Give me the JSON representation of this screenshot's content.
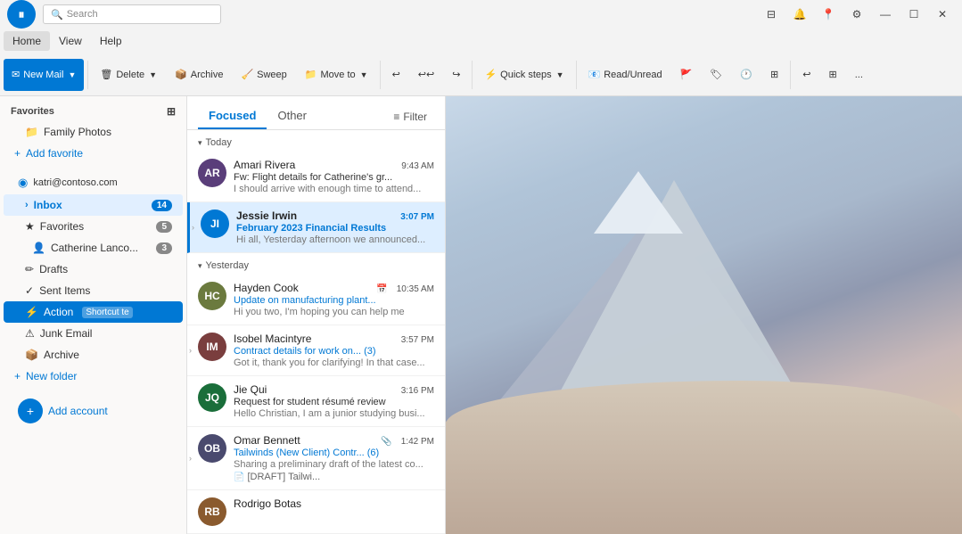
{
  "titlebar": {
    "app_name": "Outlook",
    "search_placeholder": "Search",
    "pause_icon": "⏸",
    "controls": [
      "🗗",
      "🔔",
      "📍",
      "⚙",
      "—",
      "☐",
      "✕"
    ]
  },
  "menubar": {
    "items": [
      "Home",
      "View",
      "Help"
    ]
  },
  "ribbon": {
    "new_mail": "New Mail",
    "delete": "Delete",
    "archive": "Archive",
    "sweep": "Sweep",
    "move_to": "Move to",
    "quick_steps": "Quick steps",
    "read_unread": "Read/Unread",
    "undo": "↩",
    "more": "..."
  },
  "sidebar": {
    "favorites_label": "Favorites",
    "family_photos": "Family Photos",
    "add_favorite": "Add favorite",
    "account": "katri@contoso.com",
    "inbox_label": "Inbox",
    "inbox_badge": "14",
    "favorites_sub_label": "Favorites",
    "favorites_sub_badge": "5",
    "catherine_label": "Catherine Lanco...",
    "catherine_badge": "3",
    "drafts_label": "Drafts",
    "sent_label": "Sent Items",
    "action_label": "Action",
    "action_shortcut": "Shortcut te",
    "junk_label": "Junk Email",
    "archive_label": "Archive",
    "new_folder": "New folder",
    "add_account": "Add account"
  },
  "email_list": {
    "tab_focused": "Focused",
    "tab_other": "Other",
    "filter": "Filter",
    "group_today": "Today",
    "group_yesterday": "Yesterday",
    "emails": [
      {
        "id": "e1",
        "sender": "Amari Rivera",
        "subject": "Fw: Flight details for Catherine's gr...",
        "preview": "I should arrive with enough time to attend...",
        "time": "9:43 AM",
        "time_blue": false,
        "unread": false,
        "avatar_color": "#5a3e7a",
        "avatar_initials": "AR",
        "has_expand": false,
        "selected": false
      },
      {
        "id": "e2",
        "sender": "Jessie Irwin",
        "subject": "February 2023 Financial Results",
        "preview": "Hi all, Yesterday afternoon we announced...",
        "time": "3:07 PM",
        "time_blue": true,
        "unread": true,
        "avatar_color": "#0078d4",
        "avatar_initials": "JI",
        "has_expand": true,
        "selected": true
      },
      {
        "id": "e3",
        "sender": "Hayden Cook",
        "subject": "Update on manufacturing plant...",
        "preview": "Hi you two, I'm hoping you can help me",
        "time": "10:35 AM",
        "time_blue": false,
        "unread": false,
        "avatar_color": "#6b7a3e",
        "avatar_initials": "HC",
        "has_expand": false,
        "selected": false,
        "has_icon": true
      },
      {
        "id": "e4",
        "sender": "Isobel Macintyre",
        "subject": "Contract details for work on... (3)",
        "preview": "Got it, thank you for clarifying! In that case...",
        "time": "3:57 PM",
        "time_blue": false,
        "unread": false,
        "avatar_color": "#7a3e3e",
        "avatar_initials": "IM",
        "has_expand": true,
        "selected": false
      },
      {
        "id": "e5",
        "sender": "Jie Qui",
        "subject": "Request for student résumé review",
        "preview": "Hello Christian, I am a junior studying busi...",
        "time": "3:16 PM",
        "time_blue": false,
        "unread": false,
        "avatar_color": "#1a6e3a",
        "avatar_initials": "JQ",
        "has_expand": false,
        "selected": false
      },
      {
        "id": "e6",
        "sender": "Omar Bennett",
        "subject": "Tailwinds (New Client) Contr... (6)",
        "preview": "Sharing a preliminary draft of the latest co...",
        "draft": "[DRAFT] Tailwi...",
        "time": "1:42 PM",
        "time_blue": false,
        "unread": false,
        "avatar_color": "#4a4a6e",
        "avatar_initials": "OB",
        "has_expand": true,
        "has_attachment": true,
        "selected": false
      },
      {
        "id": "e7",
        "sender": "Rodrigo Botas",
        "subject": "",
        "preview": "",
        "time": "",
        "time_blue": false,
        "unread": false,
        "avatar_color": "#8a5a2e",
        "avatar_initials": "RB",
        "has_expand": false,
        "selected": false
      }
    ]
  }
}
